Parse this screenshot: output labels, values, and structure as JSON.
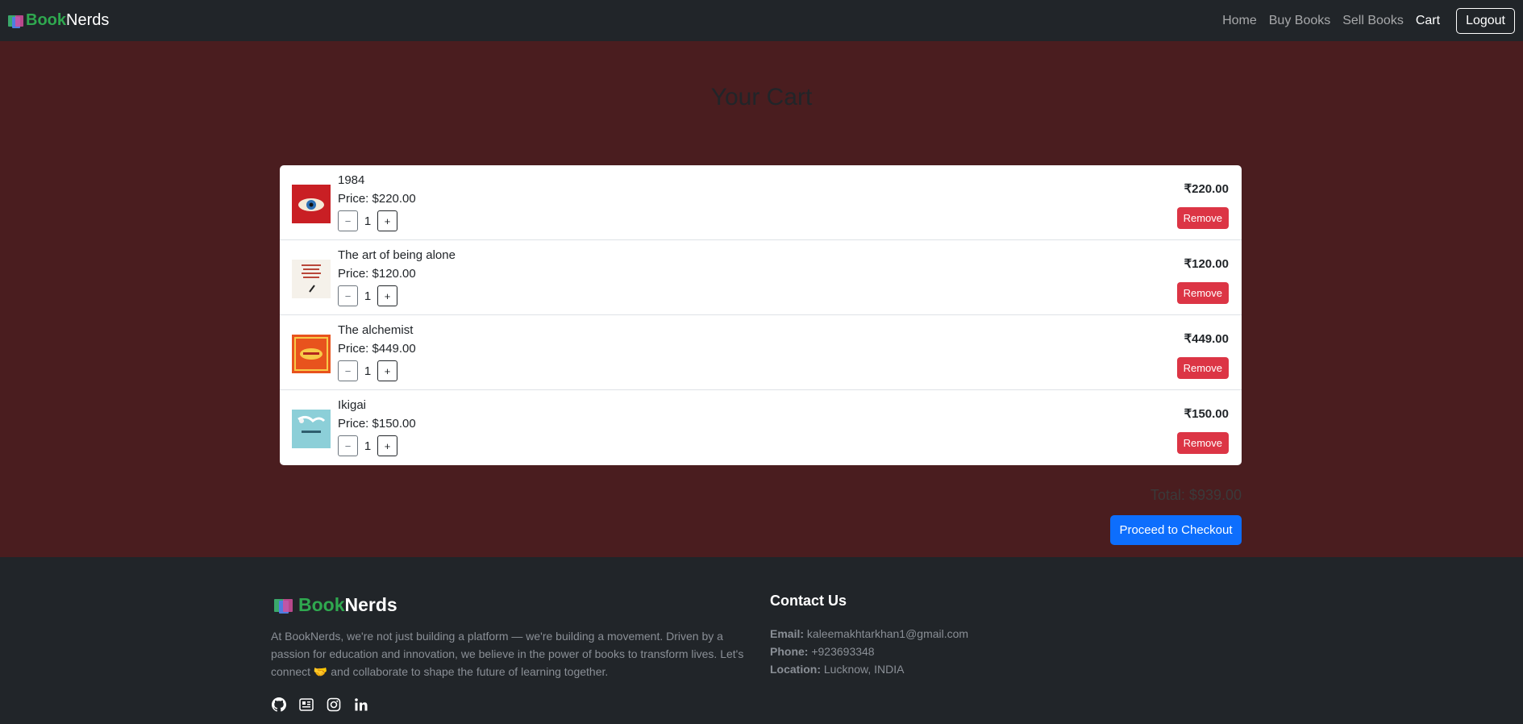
{
  "nav": {
    "brand_book": "Book",
    "brand_nerds": "Nerds",
    "links": [
      "Home",
      "Buy Books",
      "Sell Books",
      "Cart"
    ],
    "logout": "Logout"
  },
  "cart": {
    "title": "Your Cart",
    "items": [
      {
        "title": "1984",
        "price": "Price: $220.00",
        "qty": "1",
        "total": "₹220.00",
        "remove": "Remove",
        "cover_color": "#c91f24"
      },
      {
        "title": "The art of being alone",
        "price": "Price: $120.00",
        "qty": "1",
        "total": "₹120.00",
        "remove": "Remove",
        "cover_color": "#f5f1ea"
      },
      {
        "title": "The alchemist",
        "price": "Price: $449.00",
        "qty": "1",
        "total": "₹449.00",
        "remove": "Remove",
        "cover_color": "#e8531d"
      },
      {
        "title": "Ikigai",
        "price": "Price: $150.00",
        "qty": "1",
        "total": "₹150.00",
        "remove": "Remove",
        "cover_color": "#8ccfd8"
      }
    ],
    "minus": "−",
    "plus": "+",
    "total_line": "Total: $939.00",
    "checkout": "Proceed to Checkout"
  },
  "footer": {
    "brand_book": "Book",
    "brand_nerds": "Nerds",
    "about": "At BookNerds, we're not just building a platform — we're building a movement. Driven by a passion for education and innovation, we believe in the power of books to transform lives. Let's connect 🤝 and collaborate to shape the future of learning together.",
    "icons": [
      "github-icon",
      "newspaper-icon",
      "instagram-icon",
      "linkedin-icon"
    ],
    "contact_title": "Contact Us",
    "email_label": "Email:",
    "email": "kaleemakhtarkhan1@gmail.com",
    "phone_label": "Phone:",
    "phone": "+923693348",
    "location_label": "Location:",
    "location": "Lucknow, INDIA"
  },
  "colors": {
    "main_bg": "#4a1d1f",
    "nav_bg": "#212529",
    "brand_green": "#2fa84f",
    "remove_red": "#dc3545",
    "checkout_blue": "#0d6efd"
  }
}
